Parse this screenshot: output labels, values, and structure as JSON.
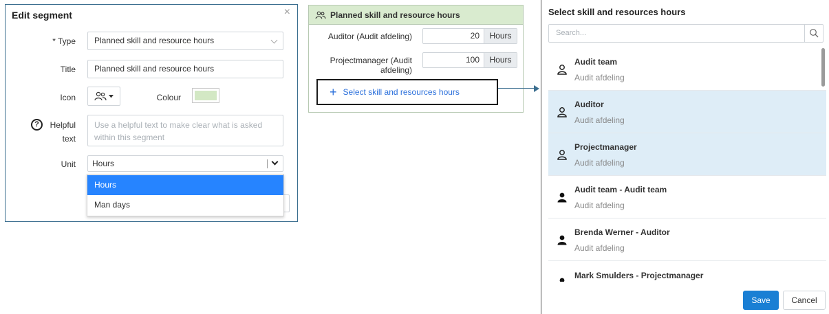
{
  "edit_segment": {
    "title": "Edit segment",
    "close_glyph": "×",
    "type_label": "* Type",
    "type_value": "Planned skill and resource hours",
    "title_label": "Title",
    "title_value": "Planned skill and resource hours",
    "icon_label": "Icon",
    "colour_label": "Colour",
    "colour_value": "#d3e8c4",
    "helpful_label_1": "Helpful",
    "helpful_label_2": "text",
    "helpful_placeholder": "Use a helpful text to make clear what is asked within this segment",
    "unit_label": "Unit",
    "unit_value": "Hours",
    "unit_options": [
      "Hours",
      "Man days"
    ]
  },
  "planned_panel": {
    "header": "Planned skill and resource hours",
    "rows": [
      {
        "label": "Auditor (Audit afdeling)",
        "value": "20",
        "unit": "Hours"
      },
      {
        "label_1": "Projectmanager (Audit",
        "label_2": "afdeling)",
        "value": "100",
        "unit": "Hours"
      }
    ],
    "select_link": "Select skill and resources hours"
  },
  "select_panel": {
    "title": "Select skill and resources hours",
    "search_placeholder": "Search...",
    "items": [
      {
        "name": "Audit team",
        "sub": "Audit afdeling",
        "icon": "user-outline-icon"
      },
      {
        "name": "Auditor",
        "sub": "Audit afdeling",
        "icon": "user-outline-icon"
      },
      {
        "name": "Projectmanager",
        "sub": "Audit afdeling",
        "icon": "user-outline-icon"
      },
      {
        "name": "Audit team - Audit team",
        "sub": "Audit afdeling",
        "icon": "user-filled-icon"
      },
      {
        "name": "Brenda Werner - Auditor",
        "sub": "Audit afdeling",
        "icon": "user-filled-icon"
      },
      {
        "name": "Mark Smulders - Projectmanager",
        "sub": "",
        "icon": "user-filled-icon"
      }
    ],
    "save_label": "Save",
    "cancel_label": "Cancel"
  },
  "colors": {
    "accent": "#1a7fd4",
    "dropdown_selected": "#2684ff",
    "highlight_row": "#deedf7",
    "planned_header": "#d9ebcf"
  }
}
